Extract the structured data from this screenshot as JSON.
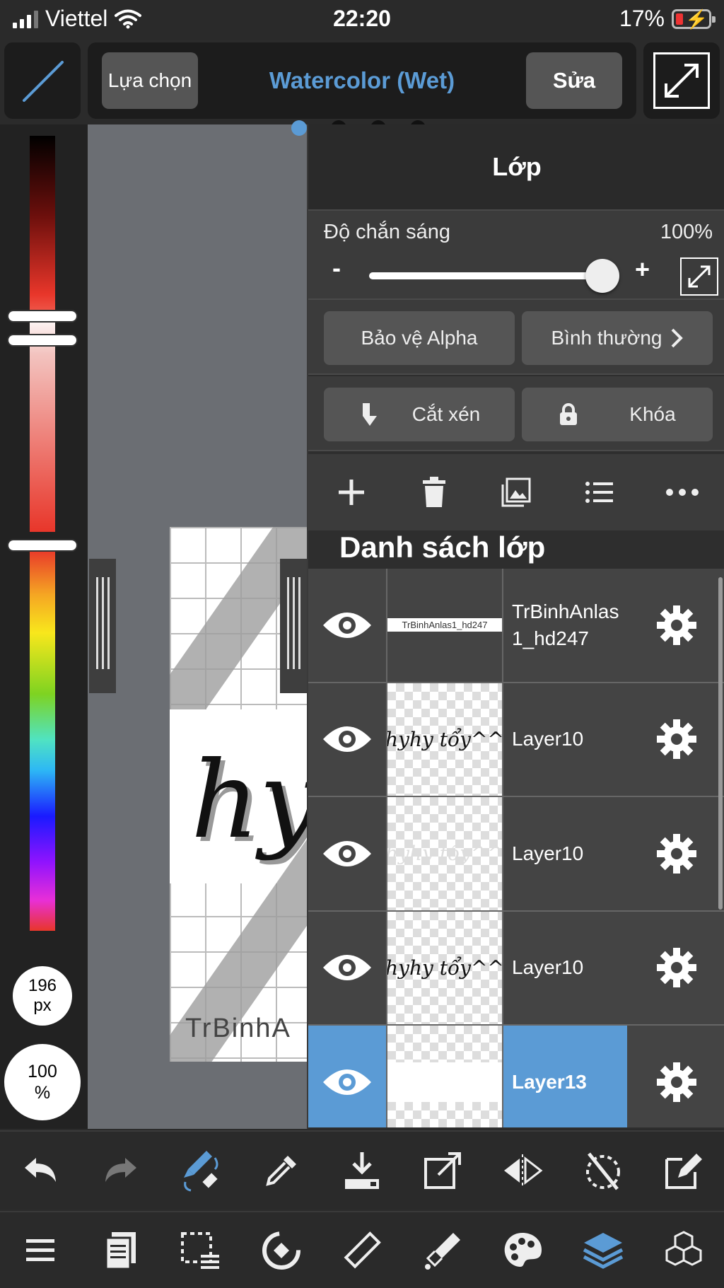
{
  "status_bar": {
    "carrier": "Viettel",
    "time": "22:20",
    "battery": "17%"
  },
  "toolbar": {
    "select_label": "Lựa chọn",
    "brush_name": "Watercolor (Wet)",
    "edit_label": "Sửa"
  },
  "left_panel": {
    "brush_size": "196",
    "size_unit": "px",
    "brush_opacity": "100",
    "opacity_unit": "%"
  },
  "canvas": {
    "signature_text": "TrBinhA",
    "script_text": "hy"
  },
  "layer_panel": {
    "title": "Lớp",
    "opacity_label": "Độ chắn sáng",
    "opacity_value": "100%",
    "opacity_level": 1.0,
    "minus": "-",
    "plus": "+",
    "alpha_protect": "Bảo vệ Alpha",
    "blend_mode": "Bình thường",
    "clipping": "Cắt xén",
    "lock": "Khóa",
    "list_title": "Danh sách lớp",
    "layers": [
      {
        "name": "TrBinhAnlas1_hd247",
        "thumb": "TrBinhAnlas1_hd247",
        "selected": false
      },
      {
        "name": "Layer10",
        "thumb": "hyhy tổy^^",
        "selected": false
      },
      {
        "name": "Layer10",
        "thumb": "hyhy tổy^^",
        "selected": false
      },
      {
        "name": "Layer10",
        "thumb": "hyhy tổy^^",
        "selected": false
      },
      {
        "name": "Layer13",
        "thumb": "",
        "selected": true
      }
    ]
  },
  "colors": {
    "accent": "#5b9bd5",
    "panel": "#2e2e2e",
    "button": "#555555",
    "selected_row": "#5b9bd5"
  },
  "icons": {
    "toolbar_bottom": [
      "undo-icon",
      "redo-icon",
      "brush-eraser-swap-icon",
      "eyedropper-icon",
      "import-icon",
      "export-canvas-icon",
      "flip-horizontal-icon",
      "rotate-lock-icon",
      "transform-icon"
    ],
    "nav_bottom": [
      "menu-icon",
      "pages-icon",
      "selection-icon",
      "snap-icon",
      "ruler-icon",
      "fill-tool-icon",
      "palette-icon",
      "layers-icon",
      "materials-icon"
    ],
    "layer_actions": [
      "add-layer-icon",
      "delete-layer-icon",
      "import-image-icon",
      "layer-menu-icon",
      "more-icon"
    ]
  }
}
